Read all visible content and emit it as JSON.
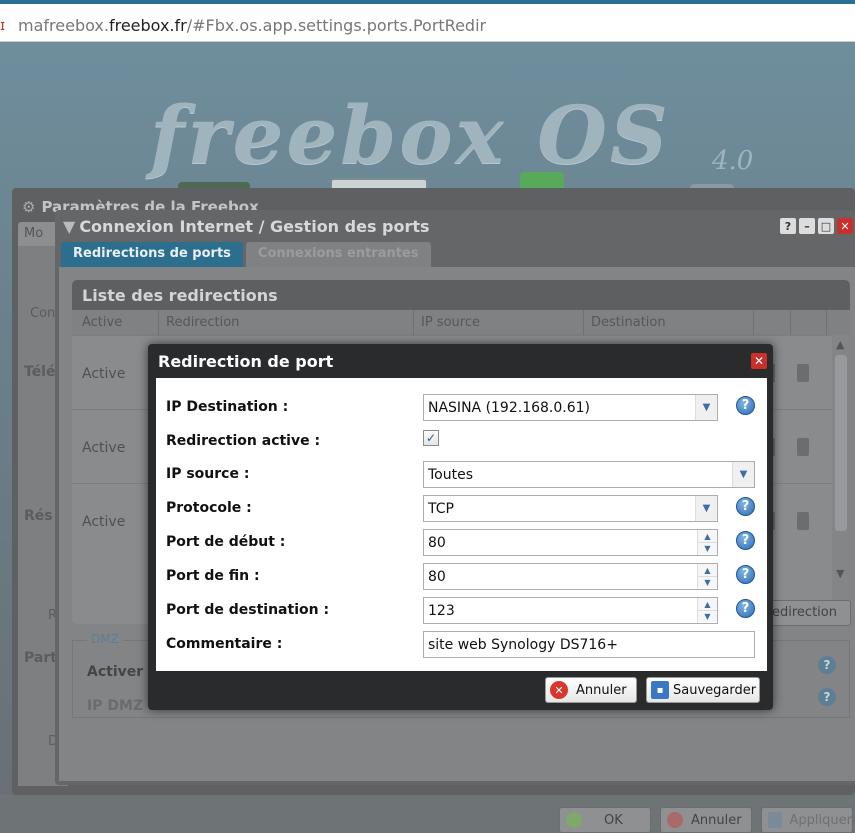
{
  "browser": {
    "url_prefix": "mafreebox.",
    "url_domain": "freebox.fr",
    "url_path": "/#Fbx.os.app.settings.ports.PortRedir"
  },
  "desktop": {
    "logo_text": "freebox OS",
    "logo_version": "4.0"
  },
  "back_window": {
    "title": "Paramètres de la Freebox",
    "tab_label": "Mo",
    "side_labels": [
      "Con",
      "Télé",
      "Rés",
      "Part",
      "R",
      "D"
    ]
  },
  "main_window": {
    "title": "Connexion Internet / Gestion des ports",
    "tabs": [
      {
        "label": "Redirections de ports",
        "active": true
      },
      {
        "label": "Connexions entrantes",
        "active": false
      }
    ],
    "list": {
      "header": "Liste des redirections",
      "columns": [
        "Active",
        "Redirection",
        "IP source",
        "Destination"
      ],
      "rows": [
        {
          "active": "Active"
        },
        {
          "active": "Active"
        },
        {
          "active": "Active"
        }
      ]
    },
    "add_button_label": "edirection",
    "dmz": {
      "legend": "DMZ",
      "activate_label": "Activer l",
      "ip_label": "IP DMZ"
    },
    "buttons": {
      "ok": "OK",
      "cancel": "Annuler",
      "apply": "Appliquer"
    }
  },
  "dialog": {
    "title": "Redirection de port",
    "fields": {
      "ip_destination_label": "IP Destination :",
      "ip_destination_value": "NASINA (192.168.0.61)",
      "redirection_active_label": "Redirection active :",
      "ip_source_label": "IP source :",
      "ip_source_value": "Toutes",
      "protocol_label": "Protocole :",
      "protocol_value": "TCP",
      "port_start_label": "Port de début :",
      "port_start_value": "80",
      "port_end_label": "Port de fin :",
      "port_end_value": "80",
      "port_dest_label": "Port de destination :",
      "port_dest_value": "123",
      "comment_label": "Commentaire :",
      "comment_value": "site web Synology DS716+"
    },
    "cancel_label": "Annuler",
    "save_label": "Sauvegarder"
  },
  "colors": {
    "modal_bg": "#2a2b2d",
    "active_tab": "#2c6e8e",
    "close_red": "#c9302c",
    "help_blue": "#2f6db5"
  },
  "icons": [
    "lock-icon",
    "gear-icon",
    "window-icon",
    "help-icon",
    "close-icon",
    "minimize-icon",
    "maximize-icon",
    "trash-icon",
    "dropdown-arrow-icon",
    "spin-up-icon",
    "spin-down-icon",
    "checkbox-check-icon",
    "cancel-icon",
    "save-icon",
    "ok-icon"
  ]
}
